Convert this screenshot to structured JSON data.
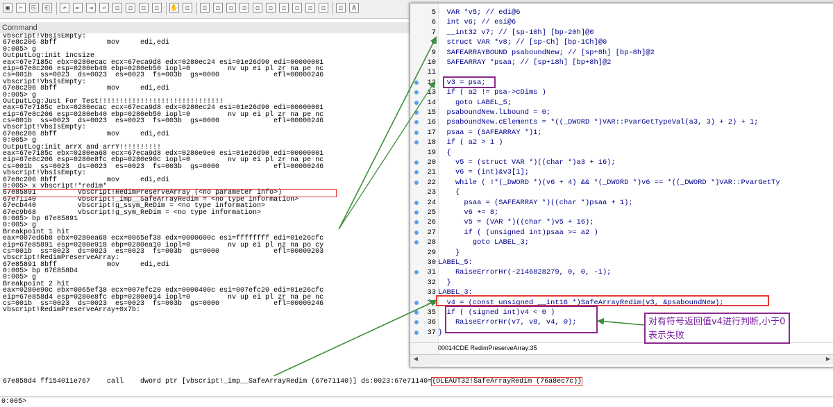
{
  "command_window": {
    "header": "Command",
    "lines": [
      "vbscript!VbsIsEmpty:",
      "67e8c206 8bff            mov     edi,edi",
      "0:005> g",
      "OutputLog:init incsize",
      "eax=67e7185c ebx=0280ecac ecx=67eca9d8 edx=0280ec24 esi=01e26d90 edi=00000001",
      "eip=67e8c206 esp=0280eb40 ebp=0280eb50 iopl=0         nv up ei pl zr na pe nc",
      "cs=001b  ss=0023  ds=0023  es=0023  fs=003b  gs=0000             efl=00000246",
      "vbscript!VbsIsEmpty:",
      "67e8c206 8bff            mov     edi,edi",
      "0:005> g",
      "OutputLog:Just For Test!!!!!!!!!!!!!!!!!!!!!!!!!!!!!!",
      "eax=67e7185c ebx=0280ecac ecx=67eca9d8 edx=0280ec24 esi=01e26d90 edi=00000001",
      "eip=67e8c206 esp=0280eb40 ebp=0280eb50 iopl=0         nv up ei pl zr na pe nc",
      "cs=001b  ss=0023  ds=0023  es=0023  fs=003b  gs=0000             efl=00000246",
      "vbscript!VbsIsEmpty:",
      "67e8c206 8bff            mov     edi,edi",
      "0:005> g",
      "OutputLog:init arrX and arrY!!!!!!!!!!",
      "eax=67e7185c ebx=0280ea68 ecx=67eca9d8 edx=0280e9e0 esi=01e26d90 edi=00000001",
      "eip=67e8c206 esp=0280e8fc ebp=0280e90c iopl=0         nv up ei pl zr na pe nc",
      "cs=001b  ss=0023  ds=0023  es=0023  fs=003b  gs=0000             efl=00000246",
      "vbscript!VbsIsEmpty:",
      "67e8c206 8bff            mov     edi,edi",
      "0:005> x vbscript!*redim*",
      "67e85891          vbscript!RedimPreserveArray (<no parameter info>)",
      "67e71140          vbscript!_imp__SafeArrayRedim = <no type information>",
      "67ecb440          vbscript!g_ssym_ReDim = <no type information>",
      "67ec9b68          vbscript!g_sym_ReDim = <no type information>",
      "0:005> bp 67e85891",
      "0:005> g",
      "Breakpoint 1 hit",
      "eax=007ed6b8 ebx=0280ea68 ecx=0065ef38 edx=0000600c esi=ffffffff edi=01e26cfc",
      "eip=67e85891 esp=0280e918 ebp=0280ea10 iopl=0         nv up ei pl nz na po cy",
      "cs=001b  ss=0023  ds=0023  es=0023  fs=003b  gs=0000             efl=00000203",
      "vbscript!RedimPreserveArray:",
      "67e85891 8bff            mov     edi,edi",
      "0:005> bp 67E858D4",
      "0:005> g",
      "Breakpoint 2 hit",
      "eax=0280e90c ebx=0065ef38 ecx=007efc20 edx=0000400c esi=007efc20 edi=01e26cfc",
      "eip=67e858d4 esp=0280e8fc ebp=0280e914 iopl=0         nv up ei pl zr na pe nc",
      "cs=001b  ss=0023  ds=0023  es=0023  fs=003b  gs=0000             efl=00000246",
      "vbscript!RedimPreserveArray+0x7b:"
    ],
    "last_line_pre": "67e858d4 ff154011e767    call    dword ptr [vbscript!_imp__SafeArrayRedim (67e71140)] ds:0023:67e71140=",
    "last_line_hl": "{OLEAUT32!SafeArrayRedim (76a8ec7c)}",
    "prompt": "0:005>"
  },
  "ida_pane": {
    "lines": [
      {
        "n": "5",
        "dot": false,
        "code": "  VAR *v5; // edi@6"
      },
      {
        "n": "6",
        "dot": false,
        "code": "  int v6; // esi@6"
      },
      {
        "n": "7",
        "dot": false,
        "code": "  __int32 v7; // [sp-10h] [bp-20h]@0"
      },
      {
        "n": "8",
        "dot": false,
        "code": "  struct VAR *v8; // [sp-Ch] [bp-1Ch]@0"
      },
      {
        "n": "9",
        "dot": false,
        "code": "  SAFEARRAYBOUND psaboundNew; // [sp+8h] [bp-8h]@2"
      },
      {
        "n": "10",
        "dot": false,
        "code": "  SAFEARRAY *psaa; // [sp+18h] [bp+8h]@2"
      },
      {
        "n": "11",
        "dot": false,
        "code": ""
      },
      {
        "n": "12",
        "dot": true,
        "code": "  v3 = psa;"
      },
      {
        "n": "13",
        "dot": true,
        "code": "  if ( a2 != psa->cDims )"
      },
      {
        "n": "14",
        "dot": true,
        "code": "    goto LABEL_5;"
      },
      {
        "n": "15",
        "dot": true,
        "code": "  psaboundNew.lLbound = 0;"
      },
      {
        "n": "16",
        "dot": true,
        "code": "  psaboundNew.cElements = *((_DWORD *)VAR::PvarGetTypeVal(a3, 3) + 2) + 1;"
      },
      {
        "n": "17",
        "dot": true,
        "code": "  psaa = (SAFEARRAY *)1;"
      },
      {
        "n": "18",
        "dot": true,
        "code": "  if ( a2 > 1 )"
      },
      {
        "n": "19",
        "dot": false,
        "code": "  {"
      },
      {
        "n": "20",
        "dot": true,
        "code": "    v5 = (struct VAR *)((char *)a3 + 16);"
      },
      {
        "n": "21",
        "dot": true,
        "code": "    v6 = (int)&v3[1];"
      },
      {
        "n": "22",
        "dot": true,
        "code": "    while ( !*(_DWORD *)(v6 + 4) && *(_DWORD *)v6 == *((_DWORD *)VAR::PvarGetTy"
      },
      {
        "n": "23",
        "dot": false,
        "code": "    {"
      },
      {
        "n": "24",
        "dot": true,
        "code": "      psaa = (SAFEARRAY *)((char *)psaa + 1);"
      },
      {
        "n": "25",
        "dot": true,
        "code": "      v6 += 8;"
      },
      {
        "n": "26",
        "dot": true,
        "code": "      v5 = (VAR *)((char *)v5 + 16);"
      },
      {
        "n": "27",
        "dot": true,
        "code": "      if ( (unsigned int)psaa >= a2 )"
      },
      {
        "n": "28",
        "dot": true,
        "code": "        goto LABEL_3;"
      },
      {
        "n": "29",
        "dot": false,
        "code": "    }"
      },
      {
        "n": "30",
        "dot": false,
        "code": "LABEL_5:"
      },
      {
        "n": "31",
        "dot": true,
        "code": "    RaiseErrorHr(-2146828279, 0, 0, -1);"
      },
      {
        "n": "32",
        "dot": false,
        "code": "  }"
      },
      {
        "n": "33",
        "dot": false,
        "code": "LABEL_3:"
      },
      {
        "n": "34",
        "dot": true,
        "code": "  v4 = (const unsigned __int16 *)SafeArrayRedim(v3, &psaboundNew);"
      },
      {
        "n": "35",
        "dot": true,
        "code": "  if ( (signed int)v4 < 0 )"
      },
      {
        "n": "36",
        "dot": true,
        "code": "    RaiseErrorHr(v7, v8, v4, 0);"
      },
      {
        "n": "37",
        "dot": true,
        "code": "}"
      }
    ],
    "status": "00014CDE RedimPreserveArray:35"
  },
  "annotation": {
    "text": "对有符号返回值v4进行判断,小于0表示失败"
  },
  "colors": {
    "code_blue": "#00008b",
    "box_purple": "#8b2a8b",
    "box_red": "#e53935",
    "arrow_green": "#3a8f3a"
  }
}
